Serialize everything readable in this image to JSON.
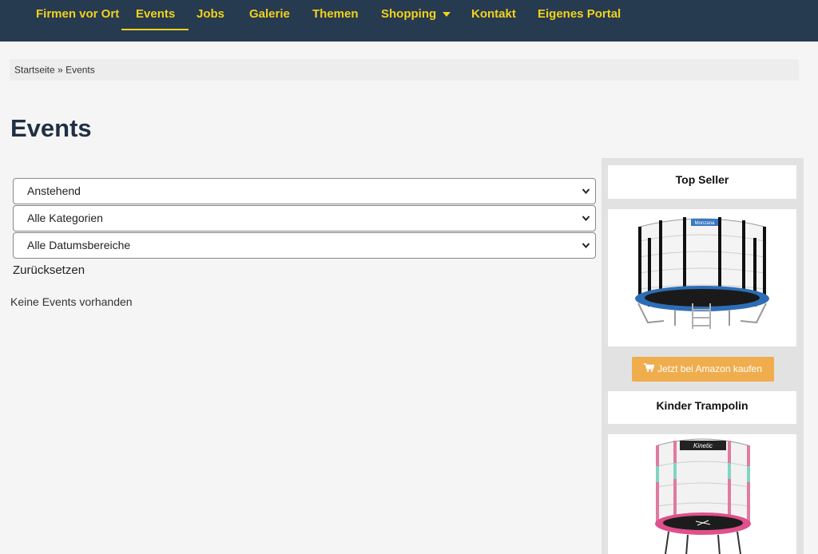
{
  "nav": {
    "items": [
      {
        "label": "Firmen vor Ort"
      },
      {
        "label": "Events",
        "active": true
      },
      {
        "label": "Jobs"
      },
      {
        "label": "Galerie"
      },
      {
        "label": "Themen"
      },
      {
        "label": "Shopping"
      },
      {
        "label": "Kontakt"
      },
      {
        "label": "Eigenes Portal"
      }
    ]
  },
  "breadcrumb": {
    "home": "Startseite",
    "separator": "»",
    "current": "Events"
  },
  "page": {
    "title": "Events",
    "empty_message": "Keine Events vorhanden"
  },
  "filters": {
    "status": "Anstehend",
    "category": "Alle Kategorien",
    "date_range": "Alle Datumsbereiche",
    "reset_label": "Zurücksetzen"
  },
  "sidebar": {
    "top_seller_heading": "Top Seller",
    "product1_brand_label": "Monzana",
    "amazon_button": "Jetzt bei Amazon kaufen",
    "kinder_heading": "Kinder Trampolin",
    "product2_brand_label": "Kinetic"
  },
  "colors": {
    "nav_bg": "#263a50",
    "nav_text": "#f2d21a",
    "title": "#1f2f45",
    "amazon_button": "#f0ad4e"
  }
}
